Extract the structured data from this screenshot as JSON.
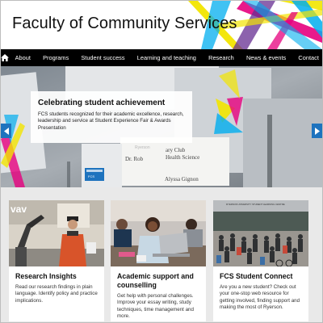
{
  "header": {
    "title": "Faculty of Community Services"
  },
  "nav": {
    "home_icon": "home-icon",
    "items": [
      "About",
      "Programs",
      "Student success",
      "Learning and teaching",
      "Research",
      "News & events",
      "Contact"
    ]
  },
  "hero": {
    "title": "Celebrating student achievement",
    "text": "FCS students recognized for their academic excellence, research, leadership and service at Student Experience Fair & Awards Presentation",
    "prev_icon": "chevron-left-icon",
    "next_icon": "chevron-right-icon",
    "certificate_name": "Alyssa Gignon",
    "certificate_lines": [
      "Dr. Rob",
      "ary Club",
      "Health Science"
    ],
    "certificate_faint": "Ryerson",
    "certificate_overlay": "FCS"
  },
  "cards": [
    {
      "title": "Research Insights",
      "text": "Read our research findings in plain language. Identify policy and practice implications.",
      "image_caption": "vav"
    },
    {
      "title": "Academic support and counselling",
      "text": "Get help with personal challenges. Improve your essay writing, study techniques, time management and more.",
      "image_caption": ""
    },
    {
      "title": "FCS Student Connect",
      "text": "Are you a new student? Check out your one-stop web resource for getting involved, finding support and making the most of Ryerson.",
      "image_caption": "RYERSON UNIVERSITY STUDENT LEARNING CENTRE"
    }
  ],
  "colors": {
    "nav_bg": "#000000",
    "accent_blue": "#1e73be",
    "deco_magenta": "#e6007e",
    "deco_yellow": "#f2e500",
    "deco_cyan": "#00aeef",
    "deco_purple": "#662d91"
  }
}
